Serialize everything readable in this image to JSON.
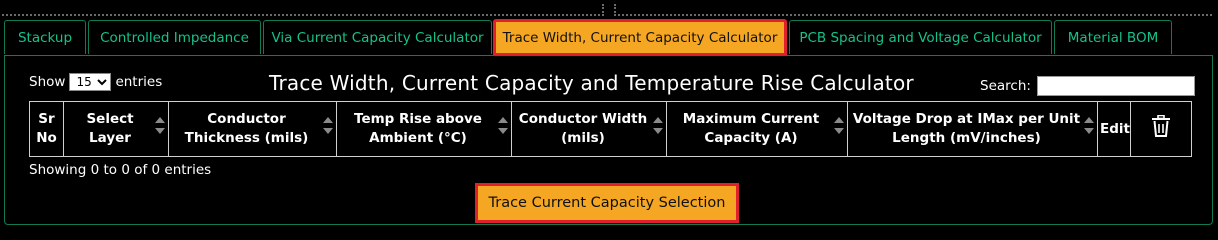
{
  "tabs": [
    {
      "label": "Stackup"
    },
    {
      "label": "Controlled Impedance"
    },
    {
      "label": "Via Current Capacity Calculator"
    },
    {
      "label": "Trace Width, Current Capacity Calculator"
    },
    {
      "label": "PCB Spacing and Voltage Calculator"
    },
    {
      "label": "Material BOM"
    }
  ],
  "show": {
    "prefix": "Show",
    "value": "15",
    "suffix": "entries"
  },
  "title": "Trace Width, Current Capacity and Temperature Rise Calculator",
  "search": {
    "label": "Search:",
    "value": ""
  },
  "columns": [
    {
      "label": "Sr No"
    },
    {
      "label": "Select Layer"
    },
    {
      "label": "Conductor Thickness (mils)"
    },
    {
      "label": "Temp Rise above Ambient (°C)"
    },
    {
      "label": "Conductor Width (mils)"
    },
    {
      "label": "Maximum Current Capacity (A)"
    },
    {
      "label": "Voltage Drop at IMax per Unit Length (mV/inches)"
    },
    {
      "label": "Edit"
    }
  ],
  "info": "Showing 0 to 0 of 0 entries",
  "action_button": "Trace Current Capacity Selection",
  "colors": {
    "accent": "#f5a623",
    "highlight_border": "#e0202a",
    "tab_text": "#14c28a"
  }
}
